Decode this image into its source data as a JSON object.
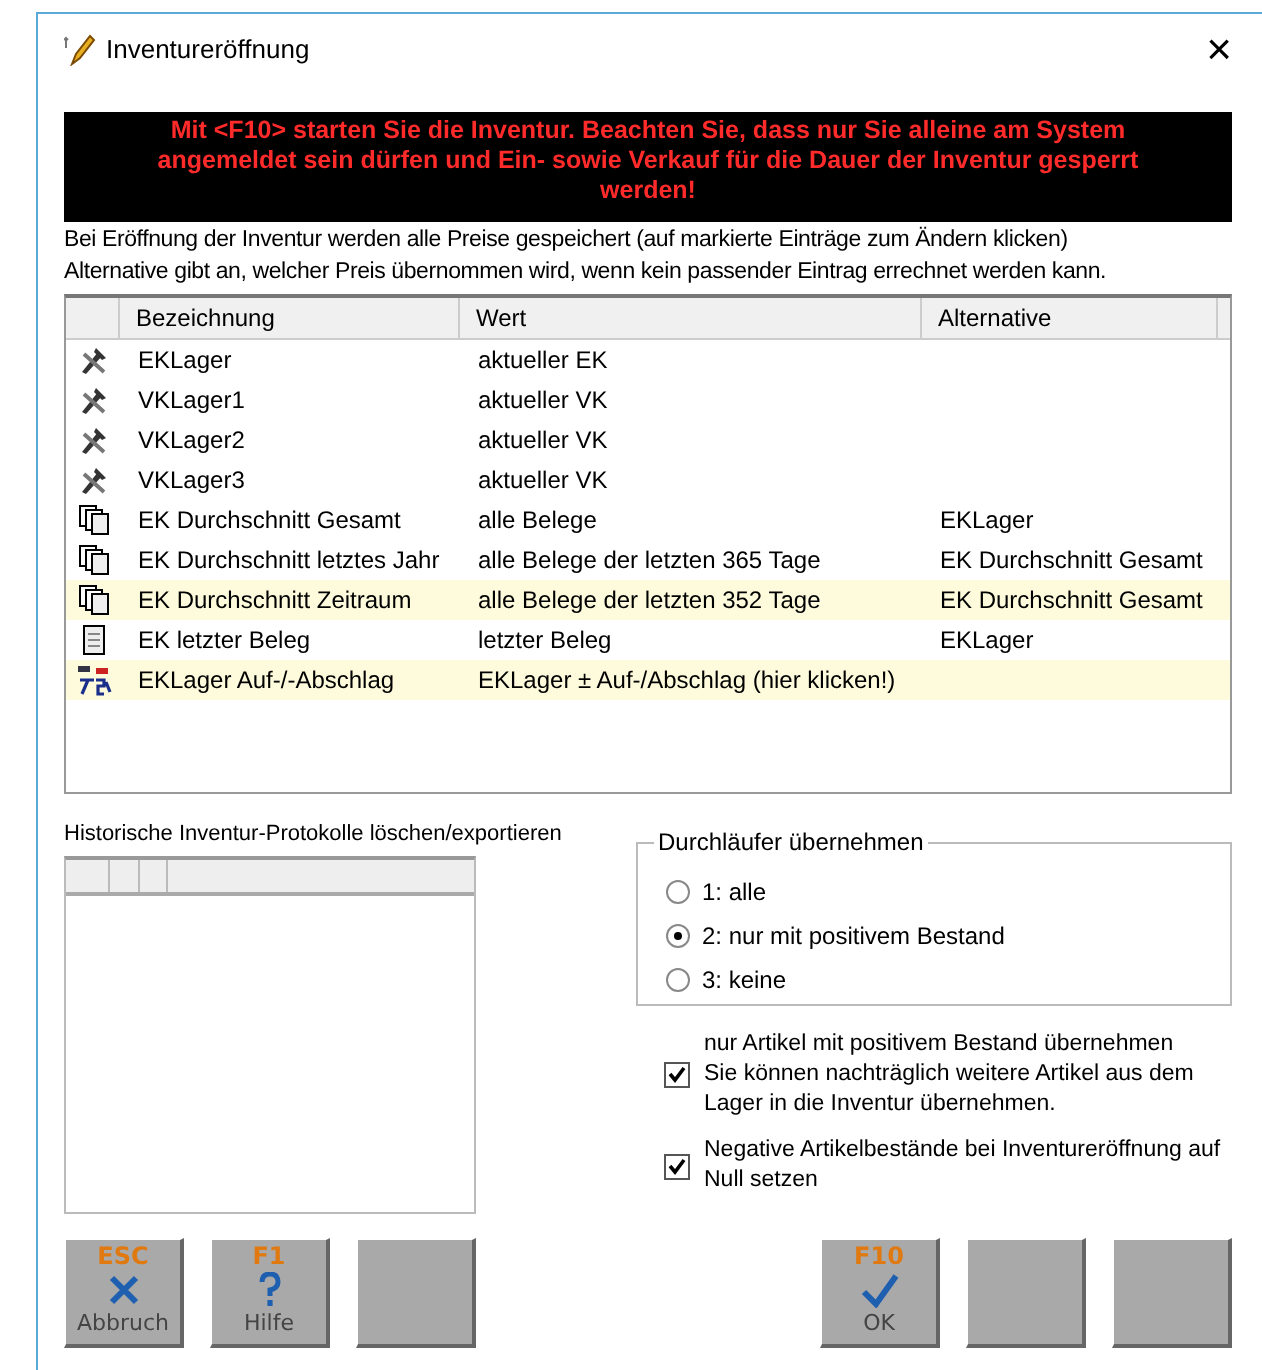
{
  "window": {
    "title": "Inventureröffnung",
    "close": "×"
  },
  "warning": "Mit <F10> starten Sie die Inventur. Beachten Sie, dass nur Sie alleine am System angemeldet sein dürfen und Ein- sowie Verkauf für die Dauer der Inventur gesperrt werden!",
  "info": [
    "Bei Eröffnung der Inventur werden alle Preise gespeichert (auf markierte Einträge zum Ändern klicken)",
    "Alternative gibt an, welcher Preis übernommen wird, wenn kein passender Eintrag errechnet werden kann."
  ],
  "table": {
    "columns": [
      "Bezeichnung",
      "Wert",
      "Alternative"
    ],
    "rows": [
      {
        "kind": "tools",
        "marked": false,
        "cells": [
          "EKLager",
          "aktueller EK",
          ""
        ]
      },
      {
        "kind": "tools",
        "marked": false,
        "cells": [
          "VKLager1",
          "aktueller VK",
          ""
        ]
      },
      {
        "kind": "tools",
        "marked": false,
        "cells": [
          "VKLager2",
          "aktueller VK",
          ""
        ]
      },
      {
        "kind": "tools",
        "marked": false,
        "cells": [
          "VKLager3",
          "aktueller VK",
          ""
        ]
      },
      {
        "kind": "documents",
        "marked": false,
        "cells": [
          "EK Durchschnitt Gesamt",
          "alle Belege",
          "EKLager"
        ]
      },
      {
        "kind": "documents",
        "marked": false,
        "cells": [
          "EK Durchschnitt letztes Jahr",
          "alle Belege der letzten 365 Tage",
          "EK Durchschnitt Gesamt"
        ]
      },
      {
        "kind": "documents",
        "marked": true,
        "cells": [
          "EK Durchschnitt Zeitraum",
          "alle Belege der letzten 352 Tage",
          "EK Durchschnitt Gesamt"
        ]
      },
      {
        "kind": "document",
        "marked": false,
        "cells": [
          "EK letzter Beleg",
          "letzter Beleg",
          "EKLager"
        ]
      },
      {
        "kind": "percent",
        "marked": true,
        "cells": [
          "EKLager Auf-/-Abschlag",
          "EKLager ± Auf-/Abschlag (hier klicken!)",
          ""
        ]
      }
    ]
  },
  "history": {
    "label": "Historische Inventur-Protokolle löschen/exportieren"
  },
  "durchlaeufer": {
    "title": "Durchläufer übernehmen",
    "options": [
      {
        "label": "1: alle",
        "selected": false
      },
      {
        "label": "2: nur mit positivem Bestand",
        "selected": true
      },
      {
        "label": "3: keine",
        "selected": false
      }
    ]
  },
  "checkboxes": [
    {
      "label": "nur Artikel mit positivem Bestand übernehmen\nSie können nachträglich weitere Artikel aus dem Lager in die Inventur übernehmen.",
      "checked": true
    },
    {
      "label": "Negative Artikelbestände bei Inventureröffnung auf Null setzen",
      "checked": true
    }
  ],
  "buttons_left": [
    {
      "kind": "cancel",
      "key": "ESC",
      "label": "Abbruch"
    },
    {
      "kind": "help",
      "key": "F1",
      "label": "Hilfe"
    },
    {
      "kind": "blank"
    }
  ],
  "buttons_right": [
    {
      "kind": "ok",
      "key": "F10",
      "label": "OK"
    },
    {
      "kind": "blank"
    },
    {
      "kind": "blank"
    }
  ]
}
